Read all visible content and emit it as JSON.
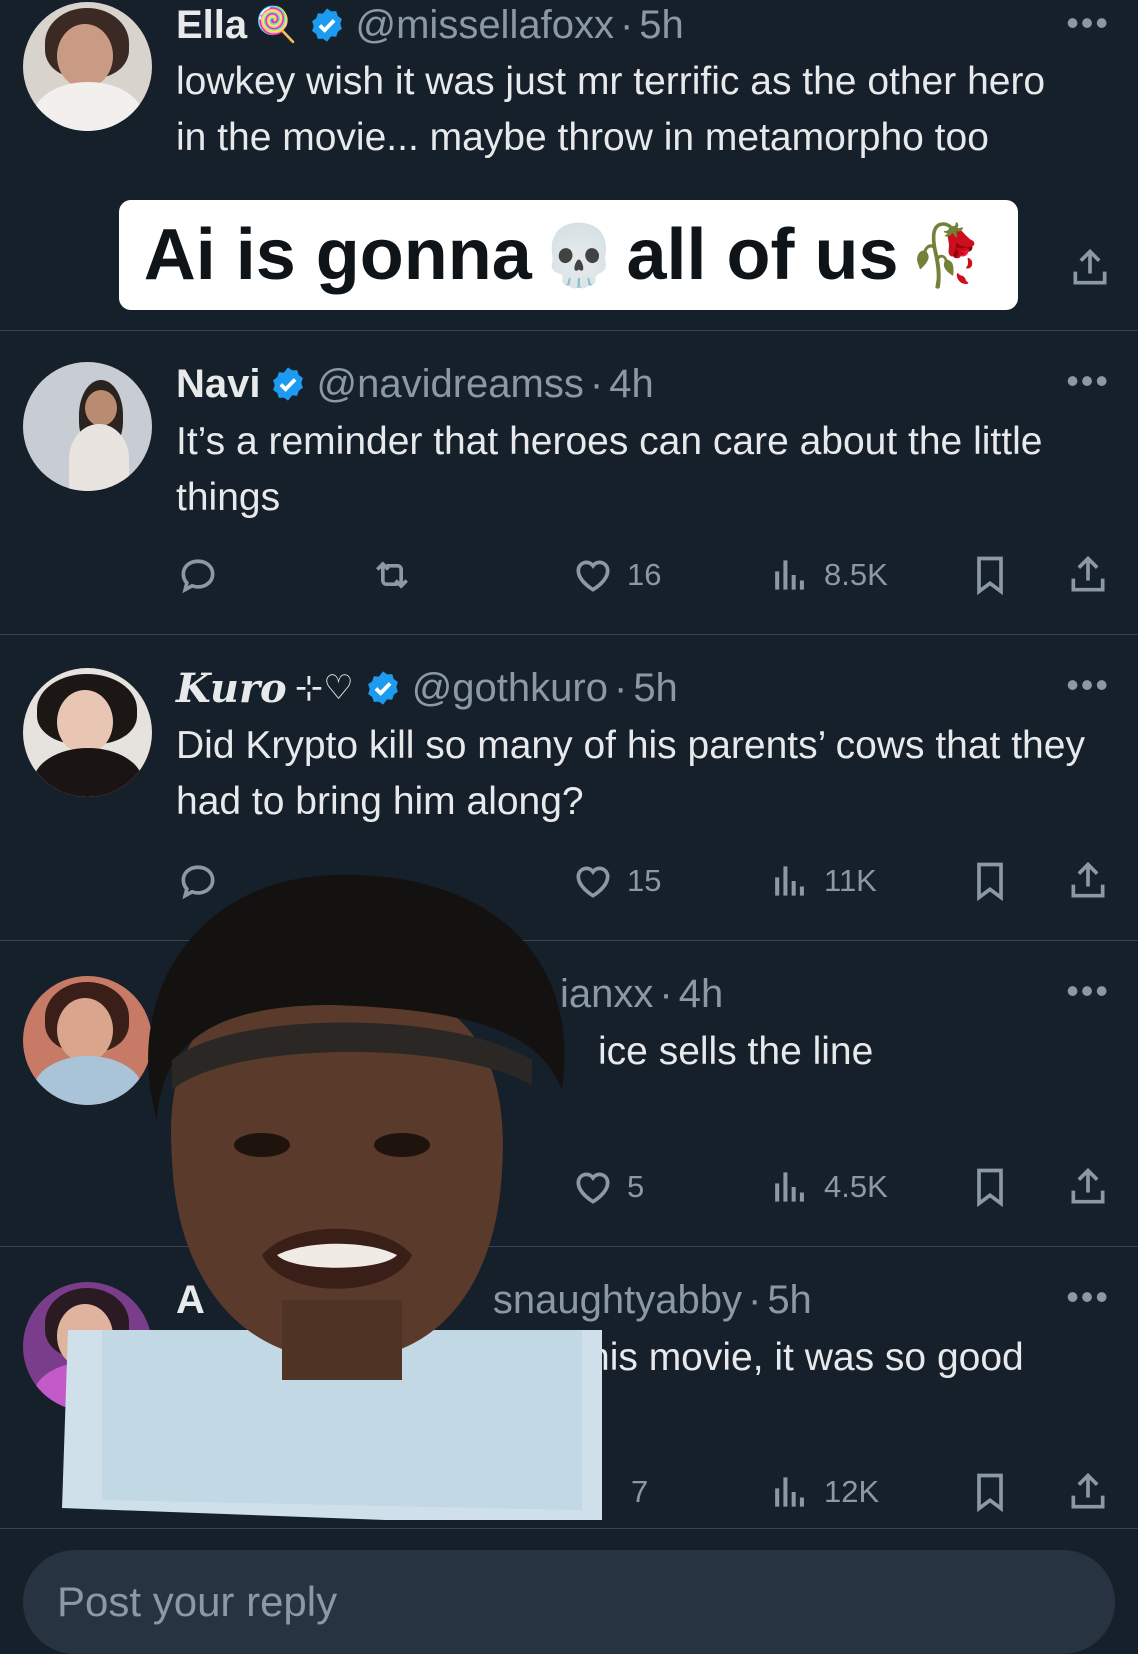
{
  "tweets": [
    {
      "name": "Ella",
      "name_emoji": "🍭",
      "handle": "@missellafoxx",
      "time": "5h",
      "text": "lowkey wish it was just mr terrific as the other hero in the movie... maybe throw in metamorpho too"
    },
    {
      "name": "Navi",
      "handle": "@navidreamss",
      "time": "4h",
      "text": "It’s a reminder that heroes can care about the little things",
      "likes": "16",
      "views": "8.5K"
    },
    {
      "name": "Kuro",
      "name_suffix": "⊹♡",
      "handle": "@gothkuro",
      "time": "5h",
      "text": "Did Krypto kill so many of his parents’ cows that they had to bring him along?",
      "likes": "15",
      "views": "11K"
    },
    {
      "handle": "ianxx",
      "time": "4h",
      "text": "ice sells the line",
      "likes": "5",
      "views": "4.5K"
    },
    {
      "name": "A",
      "handle": "snaughtyabby",
      "time": "5h",
      "text": "his movie, it was so good",
      "likes": "7",
      "views": "12K"
    }
  ],
  "separator": "·",
  "overlay": {
    "text_before": "Ai is gonna",
    "emoji_1": "💀",
    "text_after": "all of us",
    "emoji_2": "🥀"
  },
  "reply": {
    "placeholder": "Post your reply"
  },
  "colors": {
    "background": "#15202b",
    "verified": "#1d9bf0",
    "muted": "#8b98a5"
  },
  "icons": [
    "reply-icon",
    "retweet-icon",
    "like-icon",
    "views-icon",
    "bookmark-icon",
    "share-icon",
    "more-icon",
    "verified-icon"
  ]
}
